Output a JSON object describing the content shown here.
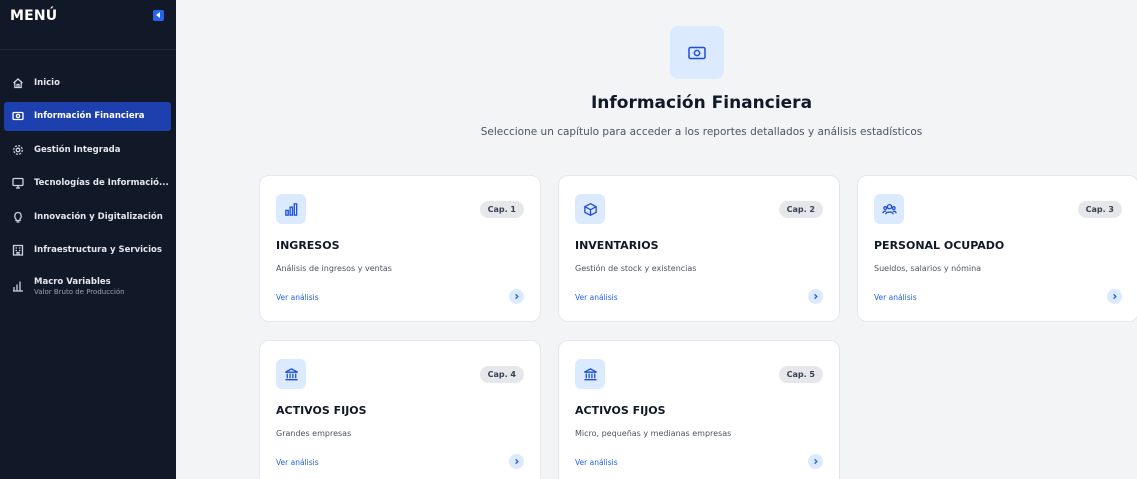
{
  "sidebar": {
    "title": "MENÚ",
    "items": [
      {
        "label": "Inicio",
        "icon": "home-icon"
      },
      {
        "label": "Información Financiera",
        "icon": "money-icon",
        "active": true
      },
      {
        "label": "Gestión Integrada",
        "icon": "gear-icon"
      },
      {
        "label": "Tecnologías de Informació...",
        "icon": "monitor-icon"
      },
      {
        "label": "Innovación y Digitalización",
        "icon": "lightbulb-icon"
      },
      {
        "label": "Infraestructura y Servicios",
        "icon": "building-icon"
      },
      {
        "label": "Macro Variables",
        "sublabel": "Valor Bruto de Producción",
        "icon": "bar-chart-icon"
      }
    ]
  },
  "header": {
    "icon": "money-icon",
    "title": "Información Financiera",
    "subtitle": "Seleccione un capítulo para acceder a los reportes detallados y análisis estadísticos"
  },
  "cards": [
    {
      "icon": "bar-chart-icon",
      "chapter": "Cap. 1",
      "title": "INGRESOS",
      "description": "Análisis de ingresos y ventas",
      "link": "Ver análisis"
    },
    {
      "icon": "box-icon",
      "chapter": "Cap. 2",
      "title": "INVENTARIOS",
      "description": "Gestión de stock y existencias",
      "link": "Ver análisis"
    },
    {
      "icon": "people-icon",
      "chapter": "Cap. 3",
      "title": "PERSONAL OCUPADO",
      "description": "Sueldos, salarios y nómina",
      "link": "Ver análisis"
    },
    {
      "icon": "bank-icon",
      "chapter": "Cap. 4",
      "title": "ACTIVOS FIJOS",
      "description": "Grandes empresas",
      "link": "Ver análisis"
    },
    {
      "icon": "bank-icon",
      "chapter": "Cap. 5",
      "title": "ACTIVOS FIJOS",
      "description": "Micro, pequeñas y medianas empresas",
      "link": "Ver análisis"
    }
  ],
  "colors": {
    "sidebar_bg": "#111827",
    "active_bg": "#1e40af",
    "accent": "#2563eb",
    "icon_bg": "#dbeafe"
  }
}
